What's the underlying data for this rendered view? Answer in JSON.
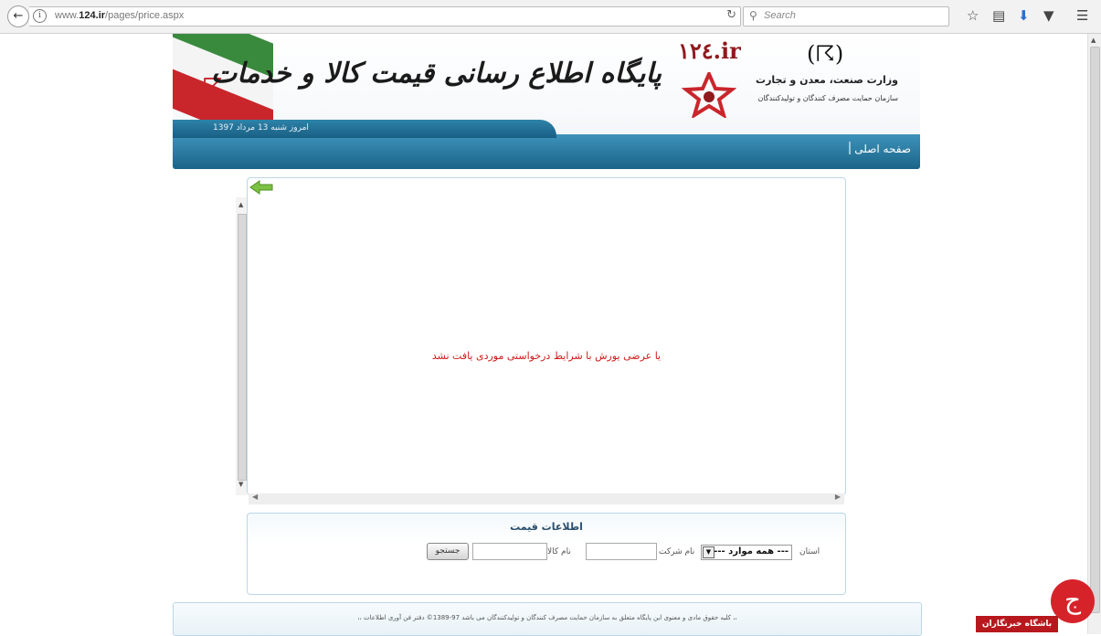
{
  "browser": {
    "url_prefix": "www.",
    "url_domain": "124.ir",
    "url_path": "/pages/price.aspx",
    "search_placeholder": "Search"
  },
  "header": {
    "title": "پایگاه اطلاع رسانی قیمت کالا و خدمات",
    "logo_text": "۱۲٤.ir",
    "ministry": "وزارت صنعت، معدن و تجارت",
    "organization": "سازمان حمایت مصرف کنندگان و تولیدکنندگان",
    "date": "امروز شنبه 13 مرداد 1397",
    "nav_home": "صفحه اصلی"
  },
  "results": {
    "empty_message": "یا عرضی یورش با شرایط درخواستی موردی یافت نشد"
  },
  "search_form": {
    "title": "اطلاعات قیمت",
    "province_label": "استان",
    "province_value": "--- همه موارد ---",
    "company_label": "نام شرکت",
    "product_label": "نام کالا",
    "search_button": "جستجو"
  },
  "footer": {
    "text": "،، کلیه حقوق مادی و معنوی این پایگاه متعلق به سازمان حمایت مصرف کنندگان و تولیدکنندگان می باشد 97-1389© دفتر فن آوری اطلاعات ،،"
  },
  "watermark": {
    "text": "باشگاه خبرنگاران",
    "glyph": "ج"
  },
  "colors": {
    "nav_blue": "#1b6488",
    "error_red": "#d01818",
    "panel_border": "#bcd7e6"
  }
}
